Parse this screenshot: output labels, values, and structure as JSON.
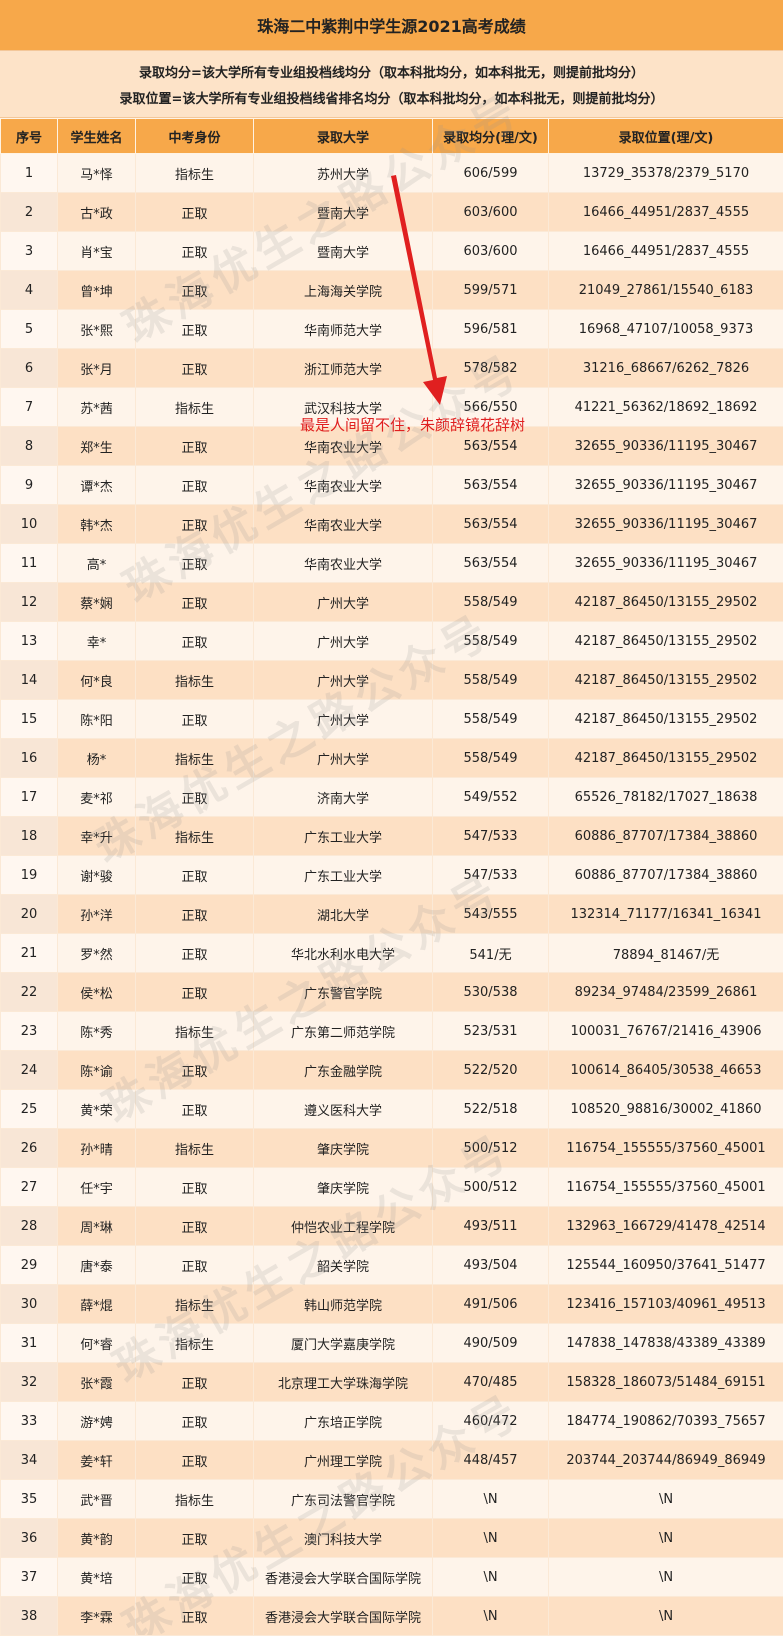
{
  "title": "珠海二中紫荆中学生源2021高考成绩",
  "notes": [
    "录取均分=该大学所有专业组投档线均分（取本科批均分，如本科批无，则提前批均分）",
    "录取位置=该大学所有专业组投档线省排名均分（取本科批均分，如本科批无，则提前批均分）"
  ],
  "columns": [
    "序号",
    "学生姓名",
    "中考身份",
    "录取大学",
    "录取均分(理/文)",
    "录取位置(理/文)"
  ],
  "rows": [
    [
      "1",
      "马*怿",
      "指标生",
      "苏州大学",
      "606/599",
      "13729_35378/2379_5170"
    ],
    [
      "2",
      "古*政",
      "正取",
      "暨南大学",
      "603/600",
      "16466_44951/2837_4555"
    ],
    [
      "3",
      "肖*宝",
      "正取",
      "暨南大学",
      "603/600",
      "16466_44951/2837_4555"
    ],
    [
      "4",
      "曾*坤",
      "正取",
      "上海海关学院",
      "599/571",
      "21049_27861/15540_6183"
    ],
    [
      "5",
      "张*熙",
      "正取",
      "华南师范大学",
      "596/581",
      "16968_47107/10058_9373"
    ],
    [
      "6",
      "张*月",
      "正取",
      "浙江师范大学",
      "578/582",
      "31216_68667/6262_7826"
    ],
    [
      "7",
      "苏*茜",
      "指标生",
      "武汉科技大学",
      "566/550",
      "41221_56362/18692_18692"
    ],
    [
      "8",
      "郑*生",
      "正取",
      "华南农业大学",
      "563/554",
      "32655_90336/11195_30467"
    ],
    [
      "9",
      "谭*杰",
      "正取",
      "华南农业大学",
      "563/554",
      "32655_90336/11195_30467"
    ],
    [
      "10",
      "韩*杰",
      "正取",
      "华南农业大学",
      "563/554",
      "32655_90336/11195_30467"
    ],
    [
      "11",
      "高*",
      "正取",
      "华南农业大学",
      "563/554",
      "32655_90336/11195_30467"
    ],
    [
      "12",
      "蔡*娴",
      "正取",
      "广州大学",
      "558/549",
      "42187_86450/13155_29502"
    ],
    [
      "13",
      "幸*",
      "正取",
      "广州大学",
      "558/549",
      "42187_86450/13155_29502"
    ],
    [
      "14",
      "何*良",
      "指标生",
      "广州大学",
      "558/549",
      "42187_86450/13155_29502"
    ],
    [
      "15",
      "陈*阳",
      "正取",
      "广州大学",
      "558/549",
      "42187_86450/13155_29502"
    ],
    [
      "16",
      "杨*",
      "指标生",
      "广州大学",
      "558/549",
      "42187_86450/13155_29502"
    ],
    [
      "17",
      "麦*祁",
      "正取",
      "济南大学",
      "549/552",
      "65526_78182/17027_18638"
    ],
    [
      "18",
      "幸*升",
      "指标生",
      "广东工业大学",
      "547/533",
      "60886_87707/17384_38860"
    ],
    [
      "19",
      "谢*骏",
      "正取",
      "广东工业大学",
      "547/533",
      "60886_87707/17384_38860"
    ],
    [
      "20",
      "孙*洋",
      "正取",
      "湖北大学",
      "543/555",
      "132314_71177/16341_16341"
    ],
    [
      "21",
      "罗*然",
      "正取",
      "华北水利水电大学",
      "541/无",
      "78894_81467/无"
    ],
    [
      "22",
      "侯*松",
      "正取",
      "广东警官学院",
      "530/538",
      "89234_97484/23599_26861"
    ],
    [
      "23",
      "陈*秀",
      "指标生",
      "广东第二师范学院",
      "523/531",
      "100031_76767/21416_43906"
    ],
    [
      "24",
      "陈*谕",
      "正取",
      "广东金融学院",
      "522/520",
      "100614_86405/30538_46653"
    ],
    [
      "25",
      "黄*荣",
      "正取",
      "遵义医科大学",
      "522/518",
      "108520_98816/30002_41860"
    ],
    [
      "26",
      "孙*晴",
      "指标生",
      "肇庆学院",
      "500/512",
      "116754_155555/37560_45001"
    ],
    [
      "27",
      "任*宇",
      "正取",
      "肇庆学院",
      "500/512",
      "116754_155555/37560_45001"
    ],
    [
      "28",
      "周*琳",
      "正取",
      "仲恺农业工程学院",
      "493/511",
      "132963_166729/41478_42514"
    ],
    [
      "29",
      "唐*泰",
      "正取",
      "韶关学院",
      "493/504",
      "125544_160950/37641_51477"
    ],
    [
      "30",
      "薛*焜",
      "指标生",
      "韩山师范学院",
      "491/506",
      "123416_157103/40961_49513"
    ],
    [
      "31",
      "何*睿",
      "指标生",
      "厦门大学嘉庚学院",
      "490/509",
      "147838_147838/43389_43389"
    ],
    [
      "32",
      "张*霞",
      "正取",
      "北京理工大学珠海学院",
      "470/485",
      "158328_186073/51484_69151"
    ],
    [
      "33",
      "游*娉",
      "正取",
      "广东培正学院",
      "460/472",
      "184774_190862/70393_75657"
    ],
    [
      "34",
      "姜*轩",
      "正取",
      "广州理工学院",
      "448/457",
      "203744_203744/86949_86949"
    ],
    [
      "35",
      "武*晋",
      "指标生",
      "广东司法警官学院",
      "\\N",
      "\\N"
    ],
    [
      "36",
      "黄*韵",
      "正取",
      "澳门科技大学",
      "\\N",
      "\\N"
    ],
    [
      "37",
      "黄*培",
      "正取",
      "香港浸会大学联合国际学院",
      "\\N",
      "\\N"
    ],
    [
      "38",
      "李*霖",
      "正取",
      "香港浸会大学联合国际学院",
      "\\N",
      "\\N"
    ]
  ],
  "annotation": "最是人间留不住，朱颜辞镜花辞树",
  "watermark": "珠海优生之路公众号",
  "colors": {
    "header_bg": "#f7a84a",
    "notes_bg": "#fde3c8",
    "row_odd": "#fef4ea",
    "row_even": "#fde0c4",
    "arrow": "#e02020"
  }
}
